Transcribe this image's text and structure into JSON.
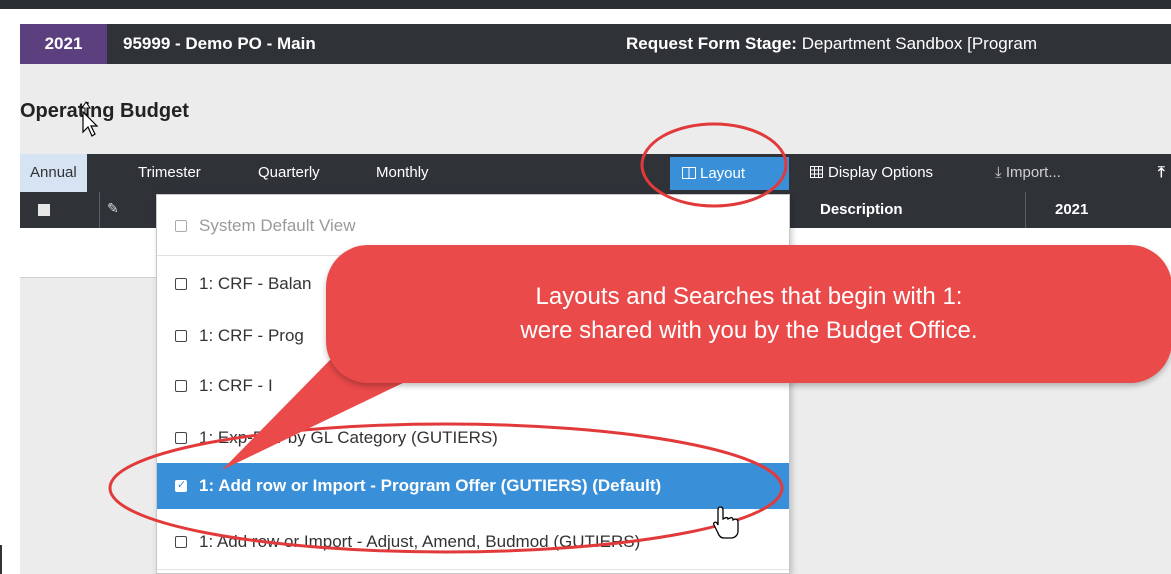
{
  "header": {
    "year": "2021",
    "project": "95999 - Demo PO - Main",
    "stage_label": "Request Form Stage:",
    "stage_value": "Department Sandbox [Program"
  },
  "page": {
    "title": "Operating Budget"
  },
  "tabs": [
    {
      "label": "Annual",
      "active": true
    },
    {
      "label": "Trimester"
    },
    {
      "label": "Quarterly"
    },
    {
      "label": "Monthly"
    }
  ],
  "toolbar": {
    "layout_label": "Layout",
    "display_options_label": "Display Options",
    "import_label": "Import..."
  },
  "grid": {
    "columns": {
      "description": "Description",
      "year": "2021"
    }
  },
  "layout_menu": {
    "items": [
      {
        "label": "System Default View",
        "muted": true
      },
      {
        "label": "1: CRF - Balan"
      },
      {
        "label": "1: CRF - Prog"
      },
      {
        "label": "1: CRF - I"
      },
      {
        "label": "1: Exp-Rev by GL Category (GUTIERS)"
      },
      {
        "label": "1: Add row or Import - Program Offer (GUTIERS) (Default)",
        "selected": true
      },
      {
        "label": "1: Add row or Import - Adjust, Amend, Budmod (GUTIERS)"
      }
    ]
  },
  "callout": {
    "line1": "Layouts and Searches that begin with 1:",
    "line2": "were shared with you by the Budget Office."
  },
  "colors": {
    "header_bg": "#2f3338",
    "year_bg": "#5b3f7e",
    "accent_blue": "#3a8fd9",
    "callout_red": "#ea4a4a",
    "annotation_red": "#e23a3a"
  }
}
